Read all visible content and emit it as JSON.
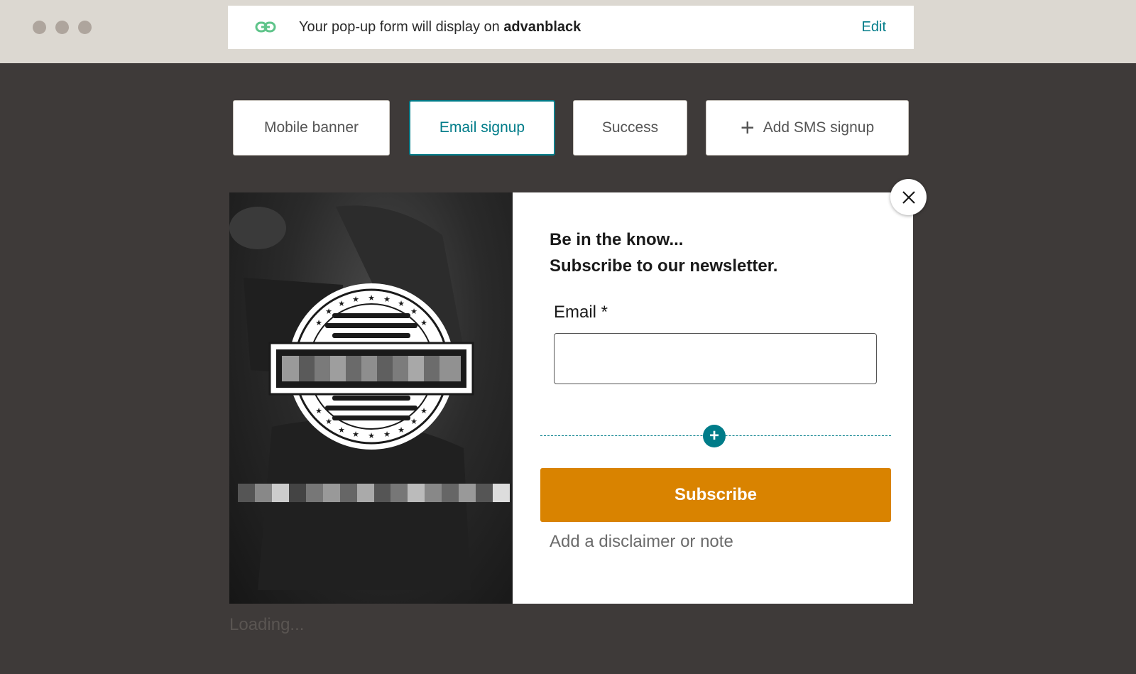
{
  "window": {
    "traffic_lights": [
      "close",
      "minimize",
      "maximize"
    ]
  },
  "urlbar": {
    "icon": "link-icon",
    "text_prefix": "Your pop-up form will display on",
    "site": "advanblack",
    "edit_label": "Edit"
  },
  "tabs": [
    {
      "label": "Mobile banner",
      "active": false
    },
    {
      "label": "Email signup",
      "active": true
    },
    {
      "label": "Success",
      "active": false
    },
    {
      "label": "Add SMS signup",
      "active": false,
      "icon": "plus-icon"
    }
  ],
  "popup": {
    "heading_line1": "Be in the know...",
    "heading_line2": "Subscribe to our newsletter.",
    "email_label": "Email *",
    "email_value": "",
    "add_field_icon": "plus-circle-icon",
    "subscribe_label": "Subscribe",
    "disclaimer": "Add a disclaimer or note",
    "close_icon": "close-icon"
  },
  "loading_text": "Loading...",
  "colors": {
    "accent": "#007c89",
    "subscribe": "#d98300",
    "background": "#3e3a39",
    "topbar": "#dcd8d1",
    "link_icon": "#5fc48a"
  }
}
